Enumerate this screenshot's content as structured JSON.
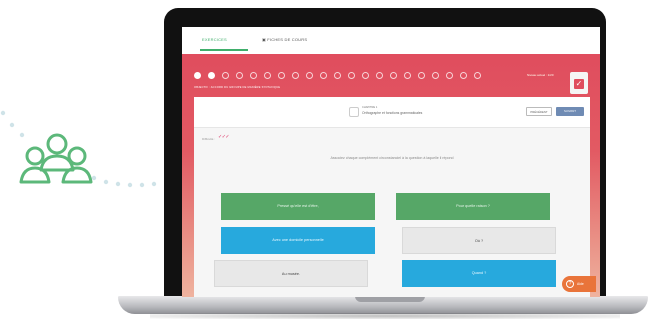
{
  "app": {
    "tabs": [
      {
        "label": "EXERCICES",
        "active": true
      },
      {
        "label": "FICHES DE COURS",
        "active": false
      }
    ],
    "progress_steps": {
      "total": 21,
      "completed": 2
    },
    "level_text": "Niveau actuel : 1/20",
    "objective_text": "OBJECTIF : ACCORD DU GROUPE DE MANIÈRE SYNTAXIQUE",
    "chapter": {
      "label": "CHAPITRE 1",
      "name": "Orthographe et fonctions grammaticales"
    },
    "nav": {
      "prev_label": "PRÉCÉDENT",
      "next_label": "SUIVANT"
    },
    "difficulty": {
      "label": "Difficulté :",
      "marks": "✓✓✓"
    },
    "instruction": "Associez chaque complément circonstanciel à la question à laquelle il répond",
    "answers": [
      {
        "text": "Pressé qu'elle est d'être,",
        "style": "green"
      },
      {
        "text": "Pour quelle raison ?",
        "style": "green"
      },
      {
        "text": "Avec une domicile personnelle",
        "style": "blue"
      },
      {
        "text": "Où ?",
        "style": "gray"
      },
      {
        "text": "Au musée.",
        "style": "gray"
      },
      {
        "text": "Quand ?",
        "style": "blue"
      }
    ],
    "help_label": "Aide",
    "colors": {
      "primary_red": "#e04d5e",
      "green": "#56a767",
      "blue": "#27a9dd",
      "orange": "#e9743a",
      "people_icon": "#5cb87a"
    }
  }
}
